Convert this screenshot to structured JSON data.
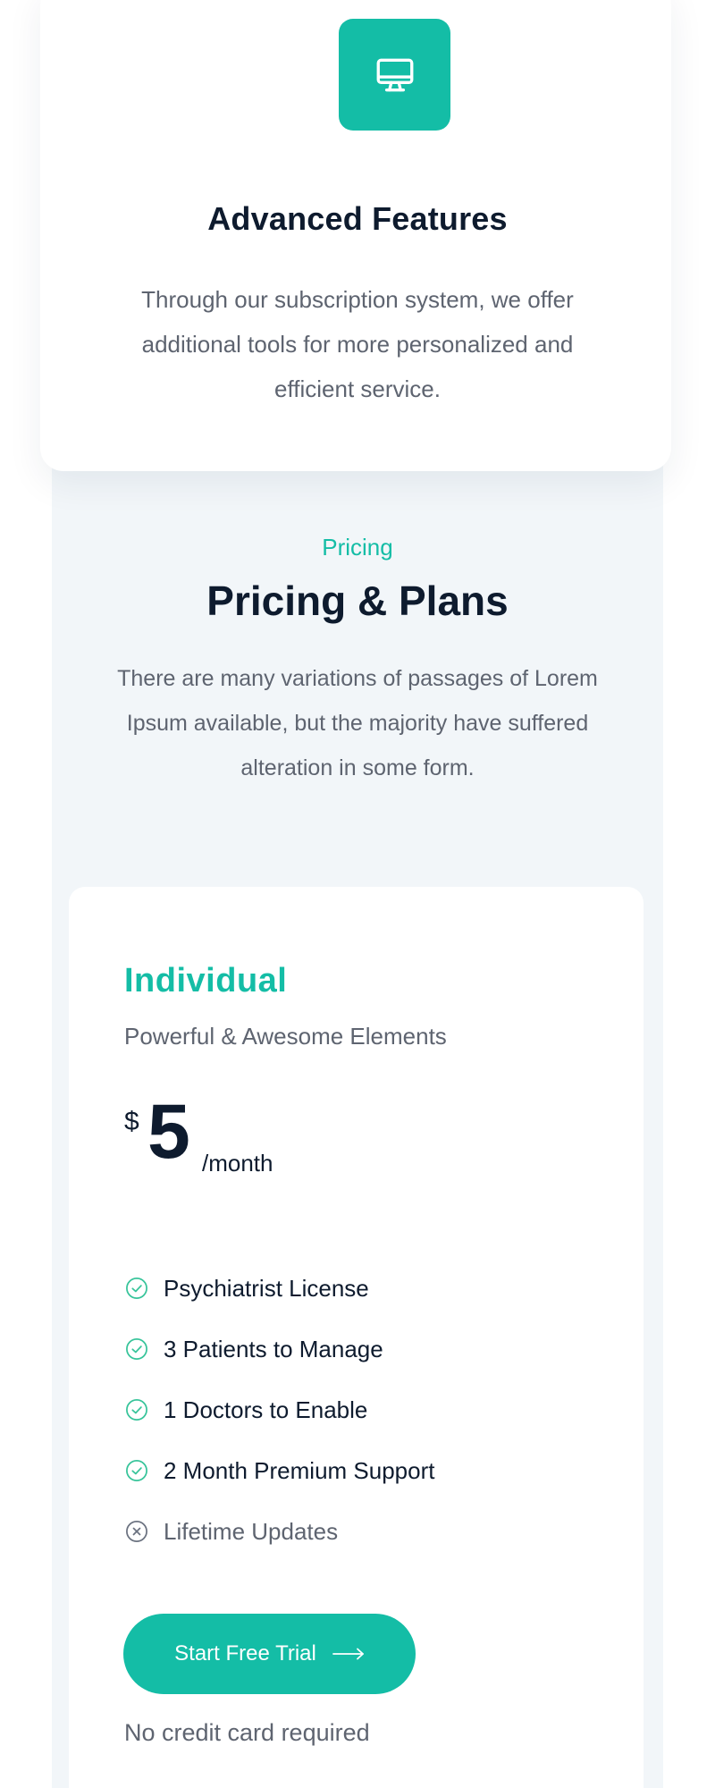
{
  "colors": {
    "accent": "#14bda6",
    "heading": "#0e1b2e",
    "body_text": "#5e6470",
    "section_bg": "#f2f6f9"
  },
  "feature_card": {
    "icon": "monitor-icon",
    "title": "Advanced Features",
    "description": "Through our subscription system, we offer additional tools for more personalized and efficient service."
  },
  "pricing": {
    "eyebrow": "Pricing",
    "title": "Pricing & Plans",
    "description": "There are many variations of passages of Lorem Ipsum available, but the majority have suffered alteration in some form."
  },
  "plan": {
    "name": "Individual",
    "tagline": "Powerful & Awesome Elements",
    "currency": "$",
    "price": "5",
    "period": "/month",
    "features": [
      {
        "label": "Psychiatrist License",
        "included": true,
        "icon": "check-circle-icon"
      },
      {
        "label": "3 Patients to Manage",
        "included": true,
        "icon": "check-circle-icon"
      },
      {
        "label": "1 Doctors to Enable",
        "included": true,
        "icon": "check-circle-icon"
      },
      {
        "label": "2 Month Premium Support",
        "included": true,
        "icon": "check-circle-icon"
      },
      {
        "label": "Lifetime Updates",
        "included": false,
        "icon": "x-circle-icon"
      }
    ],
    "cta_label": "Start Free Trial",
    "cta_icon": "arrow-right-icon",
    "cta_note": "No credit card required"
  }
}
